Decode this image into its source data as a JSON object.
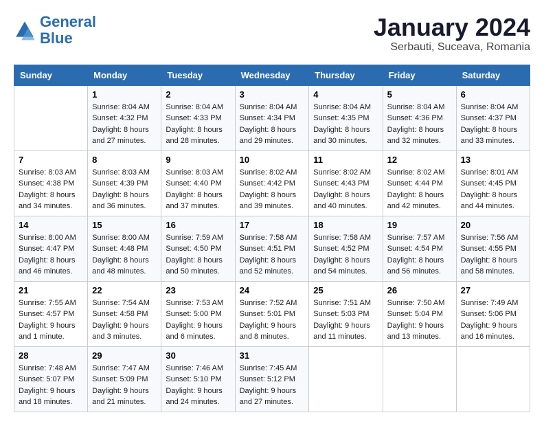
{
  "header": {
    "logo_line1": "General",
    "logo_line2": "Blue",
    "month": "January 2024",
    "location": "Serbauti, Suceava, Romania"
  },
  "days_of_week": [
    "Sunday",
    "Monday",
    "Tuesday",
    "Wednesday",
    "Thursday",
    "Friday",
    "Saturday"
  ],
  "weeks": [
    [
      {
        "day": "",
        "sunrise": "",
        "sunset": "",
        "daylight": ""
      },
      {
        "day": "1",
        "sunrise": "Sunrise: 8:04 AM",
        "sunset": "Sunset: 4:32 PM",
        "daylight": "Daylight: 8 hours and 27 minutes."
      },
      {
        "day": "2",
        "sunrise": "Sunrise: 8:04 AM",
        "sunset": "Sunset: 4:33 PM",
        "daylight": "Daylight: 8 hours and 28 minutes."
      },
      {
        "day": "3",
        "sunrise": "Sunrise: 8:04 AM",
        "sunset": "Sunset: 4:34 PM",
        "daylight": "Daylight: 8 hours and 29 minutes."
      },
      {
        "day": "4",
        "sunrise": "Sunrise: 8:04 AM",
        "sunset": "Sunset: 4:35 PM",
        "daylight": "Daylight: 8 hours and 30 minutes."
      },
      {
        "day": "5",
        "sunrise": "Sunrise: 8:04 AM",
        "sunset": "Sunset: 4:36 PM",
        "daylight": "Daylight: 8 hours and 32 minutes."
      },
      {
        "day": "6",
        "sunrise": "Sunrise: 8:04 AM",
        "sunset": "Sunset: 4:37 PM",
        "daylight": "Daylight: 8 hours and 33 minutes."
      }
    ],
    [
      {
        "day": "7",
        "sunrise": "Sunrise: 8:03 AM",
        "sunset": "Sunset: 4:38 PM",
        "daylight": "Daylight: 8 hours and 34 minutes."
      },
      {
        "day": "8",
        "sunrise": "Sunrise: 8:03 AM",
        "sunset": "Sunset: 4:39 PM",
        "daylight": "Daylight: 8 hours and 36 minutes."
      },
      {
        "day": "9",
        "sunrise": "Sunrise: 8:03 AM",
        "sunset": "Sunset: 4:40 PM",
        "daylight": "Daylight: 8 hours and 37 minutes."
      },
      {
        "day": "10",
        "sunrise": "Sunrise: 8:02 AM",
        "sunset": "Sunset: 4:42 PM",
        "daylight": "Daylight: 8 hours and 39 minutes."
      },
      {
        "day": "11",
        "sunrise": "Sunrise: 8:02 AM",
        "sunset": "Sunset: 4:43 PM",
        "daylight": "Daylight: 8 hours and 40 minutes."
      },
      {
        "day": "12",
        "sunrise": "Sunrise: 8:02 AM",
        "sunset": "Sunset: 4:44 PM",
        "daylight": "Daylight: 8 hours and 42 minutes."
      },
      {
        "day": "13",
        "sunrise": "Sunrise: 8:01 AM",
        "sunset": "Sunset: 4:45 PM",
        "daylight": "Daylight: 8 hours and 44 minutes."
      }
    ],
    [
      {
        "day": "14",
        "sunrise": "Sunrise: 8:00 AM",
        "sunset": "Sunset: 4:47 PM",
        "daylight": "Daylight: 8 hours and 46 minutes."
      },
      {
        "day": "15",
        "sunrise": "Sunrise: 8:00 AM",
        "sunset": "Sunset: 4:48 PM",
        "daylight": "Daylight: 8 hours and 48 minutes."
      },
      {
        "day": "16",
        "sunrise": "Sunrise: 7:59 AM",
        "sunset": "Sunset: 4:50 PM",
        "daylight": "Daylight: 8 hours and 50 minutes."
      },
      {
        "day": "17",
        "sunrise": "Sunrise: 7:58 AM",
        "sunset": "Sunset: 4:51 PM",
        "daylight": "Daylight: 8 hours and 52 minutes."
      },
      {
        "day": "18",
        "sunrise": "Sunrise: 7:58 AM",
        "sunset": "Sunset: 4:52 PM",
        "daylight": "Daylight: 8 hours and 54 minutes."
      },
      {
        "day": "19",
        "sunrise": "Sunrise: 7:57 AM",
        "sunset": "Sunset: 4:54 PM",
        "daylight": "Daylight: 8 hours and 56 minutes."
      },
      {
        "day": "20",
        "sunrise": "Sunrise: 7:56 AM",
        "sunset": "Sunset: 4:55 PM",
        "daylight": "Daylight: 8 hours and 58 minutes."
      }
    ],
    [
      {
        "day": "21",
        "sunrise": "Sunrise: 7:55 AM",
        "sunset": "Sunset: 4:57 PM",
        "daylight": "Daylight: 9 hours and 1 minute."
      },
      {
        "day": "22",
        "sunrise": "Sunrise: 7:54 AM",
        "sunset": "Sunset: 4:58 PM",
        "daylight": "Daylight: 9 hours and 3 minutes."
      },
      {
        "day": "23",
        "sunrise": "Sunrise: 7:53 AM",
        "sunset": "Sunset: 5:00 PM",
        "daylight": "Daylight: 9 hours and 6 minutes."
      },
      {
        "day": "24",
        "sunrise": "Sunrise: 7:52 AM",
        "sunset": "Sunset: 5:01 PM",
        "daylight": "Daylight: 9 hours and 8 minutes."
      },
      {
        "day": "25",
        "sunrise": "Sunrise: 7:51 AM",
        "sunset": "Sunset: 5:03 PM",
        "daylight": "Daylight: 9 hours and 11 minutes."
      },
      {
        "day": "26",
        "sunrise": "Sunrise: 7:50 AM",
        "sunset": "Sunset: 5:04 PM",
        "daylight": "Daylight: 9 hours and 13 minutes."
      },
      {
        "day": "27",
        "sunrise": "Sunrise: 7:49 AM",
        "sunset": "Sunset: 5:06 PM",
        "daylight": "Daylight: 9 hours and 16 minutes."
      }
    ],
    [
      {
        "day": "28",
        "sunrise": "Sunrise: 7:48 AM",
        "sunset": "Sunset: 5:07 PM",
        "daylight": "Daylight: 9 hours and 18 minutes."
      },
      {
        "day": "29",
        "sunrise": "Sunrise: 7:47 AM",
        "sunset": "Sunset: 5:09 PM",
        "daylight": "Daylight: 9 hours and 21 minutes."
      },
      {
        "day": "30",
        "sunrise": "Sunrise: 7:46 AM",
        "sunset": "Sunset: 5:10 PM",
        "daylight": "Daylight: 9 hours and 24 minutes."
      },
      {
        "day": "31",
        "sunrise": "Sunrise: 7:45 AM",
        "sunset": "Sunset: 5:12 PM",
        "daylight": "Daylight: 9 hours and 27 minutes."
      },
      {
        "day": "",
        "sunrise": "",
        "sunset": "",
        "daylight": ""
      },
      {
        "day": "",
        "sunrise": "",
        "sunset": "",
        "daylight": ""
      },
      {
        "day": "",
        "sunrise": "",
        "sunset": "",
        "daylight": ""
      }
    ]
  ]
}
